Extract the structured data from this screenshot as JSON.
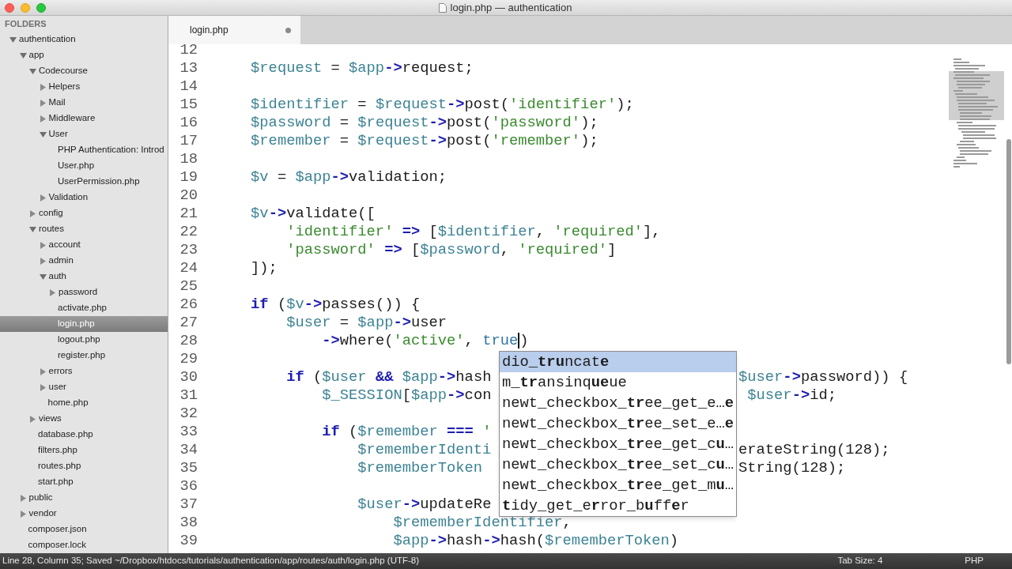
{
  "window": {
    "title": "login.php — authentication"
  },
  "sidebar": {
    "header": "FOLDERS",
    "tree": [
      {
        "label": "authentication",
        "kind": "folder",
        "expanded": true,
        "selected": false,
        "children": [
          {
            "label": "app",
            "kind": "folder",
            "expanded": true,
            "selected": false,
            "children": [
              {
                "label": "Codecourse",
                "kind": "folder",
                "expanded": true,
                "selected": false,
                "children": [
                  {
                    "label": "Helpers",
                    "kind": "folder",
                    "expanded": false,
                    "selected": false
                  },
                  {
                    "label": "Mail",
                    "kind": "folder",
                    "expanded": false,
                    "selected": false
                  },
                  {
                    "label": "Middleware",
                    "kind": "folder",
                    "expanded": false,
                    "selected": false
                  },
                  {
                    "label": "User",
                    "kind": "folder",
                    "expanded": true,
                    "selected": false,
                    "children": [
                      {
                        "label": "PHP Authentication: Introd",
                        "kind": "file",
                        "selected": false
                      },
                      {
                        "label": "User.php",
                        "kind": "file",
                        "selected": false
                      },
                      {
                        "label": "UserPermission.php",
                        "kind": "file",
                        "selected": false
                      }
                    ]
                  },
                  {
                    "label": "Validation",
                    "kind": "folder",
                    "expanded": false,
                    "selected": false
                  }
                ]
              },
              {
                "label": "config",
                "kind": "folder",
                "expanded": false,
                "selected": false
              },
              {
                "label": "routes",
                "kind": "folder",
                "expanded": true,
                "selected": false,
                "children": [
                  {
                    "label": "account",
                    "kind": "folder",
                    "expanded": false,
                    "selected": false
                  },
                  {
                    "label": "admin",
                    "kind": "folder",
                    "expanded": false,
                    "selected": false
                  },
                  {
                    "label": "auth",
                    "kind": "folder",
                    "expanded": true,
                    "selected": false,
                    "children": [
                      {
                        "label": "password",
                        "kind": "folder",
                        "expanded": false,
                        "selected": false
                      },
                      {
                        "label": "activate.php",
                        "kind": "file",
                        "selected": false
                      },
                      {
                        "label": "login.php",
                        "kind": "file",
                        "selected": true
                      },
                      {
                        "label": "logout.php",
                        "kind": "file",
                        "selected": false
                      },
                      {
                        "label": "register.php",
                        "kind": "file",
                        "selected": false
                      }
                    ]
                  },
                  {
                    "label": "errors",
                    "kind": "folder",
                    "expanded": false,
                    "selected": false
                  },
                  {
                    "label": "user",
                    "kind": "folder",
                    "expanded": false,
                    "selected": false
                  },
                  {
                    "label": "home.php",
                    "kind": "file",
                    "selected": false
                  }
                ]
              },
              {
                "label": "views",
                "kind": "folder",
                "expanded": false,
                "selected": false
              },
              {
                "label": "database.php",
                "kind": "file",
                "selected": false
              },
              {
                "label": "filters.php",
                "kind": "file",
                "selected": false
              },
              {
                "label": "routes.php",
                "kind": "file",
                "selected": false
              },
              {
                "label": "start.php",
                "kind": "file",
                "selected": false
              }
            ]
          },
          {
            "label": "public",
            "kind": "folder",
            "expanded": false,
            "selected": false
          },
          {
            "label": "vendor",
            "kind": "folder",
            "expanded": false,
            "selected": false
          },
          {
            "label": "composer.json",
            "kind": "file",
            "selected": false
          },
          {
            "label": "composer.lock",
            "kind": "file",
            "selected": false
          }
        ]
      }
    ]
  },
  "tabs": [
    {
      "label": "login.php",
      "selected": true,
      "modified": true
    }
  ],
  "editor": {
    "lines": [
      {
        "number": "12"
      },
      {
        "number": "13",
        "tokens": [
          {
            "var": "    $request"
          },
          {
            "plain": " = "
          },
          {
            "var": "$app"
          },
          {
            "op": "->"
          },
          {
            "plain": "request;"
          }
        ]
      },
      {
        "number": "14"
      },
      {
        "number": "15",
        "tokens": [
          {
            "var": "    $identifier"
          },
          {
            "plain": " = "
          },
          {
            "var": "$request"
          },
          {
            "op": "->"
          },
          {
            "plain": "post("
          },
          {
            "str": "'identifier'"
          },
          {
            "plain": ");"
          }
        ]
      },
      {
        "number": "16",
        "tokens": [
          {
            "var": "    $password"
          },
          {
            "plain": " = "
          },
          {
            "var": "$request"
          },
          {
            "op": "->"
          },
          {
            "plain": "post("
          },
          {
            "str": "'password'"
          },
          {
            "plain": ");"
          }
        ]
      },
      {
        "number": "17",
        "tokens": [
          {
            "var": "    $remember"
          },
          {
            "plain": " = "
          },
          {
            "var": "$request"
          },
          {
            "op": "->"
          },
          {
            "plain": "post("
          },
          {
            "str": "'remember'"
          },
          {
            "plain": ");"
          }
        ]
      },
      {
        "number": "18"
      },
      {
        "number": "19",
        "tokens": [
          {
            "var": "    $v"
          },
          {
            "plain": " = "
          },
          {
            "var": "$app"
          },
          {
            "op": "->"
          },
          {
            "plain": "validation;"
          }
        ]
      },
      {
        "number": "20"
      },
      {
        "number": "21",
        "tokens": [
          {
            "var": "    $v"
          },
          {
            "op": "->"
          },
          {
            "plain": "validate(["
          }
        ]
      },
      {
        "number": "22",
        "tokens": [
          {
            "str": "        'identifier'"
          },
          {
            "op": " =>"
          },
          {
            "plain": " ["
          },
          {
            "var": "$identifier"
          },
          {
            "plain": ", "
          },
          {
            "str": "'required'"
          },
          {
            "plain": "],"
          }
        ]
      },
      {
        "number": "23",
        "tokens": [
          {
            "str": "        'password'"
          },
          {
            "op": " =>"
          },
          {
            "plain": " ["
          },
          {
            "var": "$password"
          },
          {
            "plain": ", "
          },
          {
            "str": "'required'"
          },
          {
            "plain": "]"
          }
        ]
      },
      {
        "number": "24",
        "tokens": [
          {
            "plain": "    ]);"
          }
        ]
      },
      {
        "number": "25"
      },
      {
        "number": "26",
        "tokens": [
          {
            "kw": "    if"
          },
          {
            "plain": " ("
          },
          {
            "var": "$v"
          },
          {
            "op": "->"
          },
          {
            "plain": "passes()) {"
          }
        ]
      },
      {
        "number": "27",
        "tokens": [
          {
            "var": "        $user"
          },
          {
            "plain": " = "
          },
          {
            "var": "$app"
          },
          {
            "op": "->"
          },
          {
            "plain": "user"
          }
        ]
      },
      {
        "number": "28",
        "tokens": [
          {
            "op": "            ->"
          },
          {
            "plain": "where("
          },
          {
            "str": "'active'"
          },
          {
            "plain": ", "
          },
          {
            "const": "true"
          },
          {
            "cursor": true
          },
          {
            "plain": ")"
          }
        ]
      },
      {
        "number": "29"
      },
      {
        "number": "30",
        "tokens": [
          {
            "kw": "        if"
          },
          {
            "plain": " ("
          },
          {
            "var": "$user"
          },
          {
            "op": " &&"
          },
          {
            "var": " $app"
          },
          {
            "op": "->"
          },
          {
            "plain": "hash"
          }
        ],
        "right": [
          {
            "var": "$user"
          },
          {
            "op": "->"
          },
          {
            "plain": "password)) {"
          }
        ]
      },
      {
        "number": "31",
        "tokens": [
          {
            "var": "            $_SESSION"
          },
          {
            "plain": "["
          },
          {
            "var": "$app"
          },
          {
            "op": "->"
          },
          {
            "plain": "con"
          }
        ],
        "right": [
          {
            "var": " $user"
          },
          {
            "op": "->"
          },
          {
            "plain": "id;"
          }
        ]
      },
      {
        "number": "32"
      },
      {
        "number": "33",
        "tokens": [
          {
            "kw": "            if"
          },
          {
            "plain": " ("
          },
          {
            "var": "$remember"
          },
          {
            "op": " ==="
          },
          {
            "str": " '"
          }
        ]
      },
      {
        "number": "34",
        "tokens": [
          {
            "var": "                $rememberIdenti"
          }
        ],
        "right": [
          {
            "plain": "erateString(128);"
          }
        ]
      },
      {
        "number": "35",
        "tokens": [
          {
            "var": "                $rememberToken"
          }
        ],
        "right": [
          {
            "plain": "String(128);"
          }
        ]
      },
      {
        "number": "36"
      },
      {
        "number": "37",
        "tokens": [
          {
            "var": "                $user"
          },
          {
            "op": "->"
          },
          {
            "plain": "updateRe"
          }
        ]
      },
      {
        "number": "38",
        "tokens": [
          {
            "var": "                    $rememberIdentifier"
          },
          {
            "plain": ","
          }
        ]
      },
      {
        "number": "39",
        "tokens": [
          {
            "var": "                    $app"
          },
          {
            "op": "->"
          },
          {
            "plain": "hash"
          },
          {
            "op": "->"
          },
          {
            "plain": "hash("
          },
          {
            "var": "$rememberToken"
          },
          {
            "plain": ")"
          }
        ]
      }
    ],
    "autocomplete": {
      "items": [
        {
          "label": "dio_**tru**ncat**e**",
          "selected": true
        },
        {
          "label": "m_**tr**ansinq**ue**ue",
          "selected": false
        },
        {
          "label": "newt_checkbox_**tr**ee_get_e…**e**",
          "selected": false
        },
        {
          "label": "newt_checkbox_**tr**ee_set_e…**e**",
          "selected": false
        },
        {
          "label": "newt_checkbox_**tr**ee_get_c**u**…",
          "selected": false
        },
        {
          "label": "newt_checkbox_**tr**ee_set_c**u**…",
          "selected": false
        },
        {
          "label": "newt_checkbox_**tr**ee_get_m**u**…",
          "selected": false
        },
        {
          "label": "**t**idy_get_e**r**ror_b**u**ff**e**r",
          "selected": false
        }
      ]
    }
  },
  "status_bar": {
    "position": "Line 28, Column 35; Saved ~/Dropbox/htdocs/tutorials/authentication/app/routes/auth/login.php (UTF-8)",
    "tab_size": "Tab Size: 4",
    "syntax": "PHP"
  }
}
